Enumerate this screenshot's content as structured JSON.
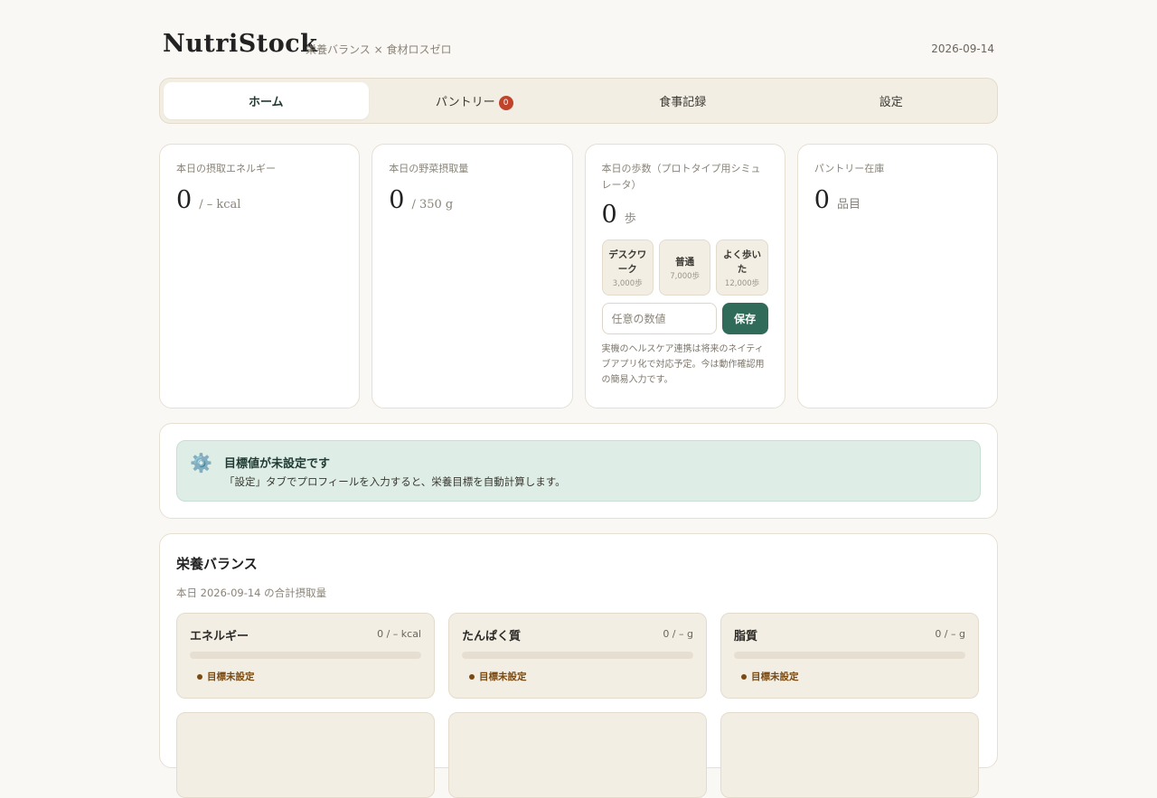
{
  "header": {
    "brand": "NutriStock",
    "tagline": "栄養バランス × 食材ロスゼロ",
    "date": "2026-09-14"
  },
  "tabs": [
    {
      "label": "ホーム",
      "active": true
    },
    {
      "label": "パントリー",
      "badge": "0"
    },
    {
      "label": "食事記録"
    },
    {
      "label": "設定"
    }
  ],
  "stats": {
    "energy": {
      "label": "本日の摂取エネルギー",
      "value": "0",
      "unit": "/ – kcal"
    },
    "veg": {
      "label": "本日の野菜摂取量",
      "value": "0",
      "unit": "/ 350 g"
    },
    "steps": {
      "label": "本日の歩数（プロトタイプ用シミュレータ）",
      "value": "0",
      "unit": "歩",
      "presets": [
        {
          "title": "デスクワーク",
          "sub": "3,000歩"
        },
        {
          "title": "普通",
          "sub": "7,000歩"
        },
        {
          "title": "よく歩いた",
          "sub": "12,000歩"
        }
      ],
      "input_placeholder": "任意の数値",
      "save_label": "保存",
      "note": "実機のヘルスケア連携は将来のネイティブアプリ化で対応予定。今は動作確認用の簡易入力です。"
    },
    "pantry": {
      "label": "パントリー在庫",
      "value": "0",
      "unit": "品目"
    }
  },
  "notice": {
    "icon": "⚙️",
    "title": "目標値が未設定です",
    "text": "「設定」タブでプロフィールを入力すると、栄養目標を自動計算します。"
  },
  "nutrition": {
    "title": "栄養バランス",
    "subtitle": "本日 2026-09-14 の合計摂取量",
    "items": [
      {
        "name": "エネルギー",
        "amount": "0 / – kcal",
        "status": "目標未設定"
      },
      {
        "name": "たんぱく質",
        "amount": "0 / – g",
        "status": "目標未設定"
      },
      {
        "name": "脂質",
        "amount": "0 / – g",
        "status": "目標未設定"
      }
    ]
  },
  "colors": {
    "accent": "#2f6b58",
    "badge": "#c0432c",
    "notice_bg": "#deede6",
    "status": "#7a4a12"
  }
}
